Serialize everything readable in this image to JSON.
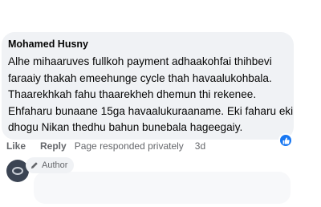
{
  "comment": {
    "author": "Mohamed Husny",
    "lines": [
      "Alhe mihaaruves fullkoh payment adhaakohfai thihbevi",
      "faraaiy thakah emeehunge cycle thah havaalukohbala.",
      "Thaarekhkah fahu thaarekheh dhemun thi rekenee.",
      "Ehfaharu bunaane 15ga havaalukuraaname. Eki faharu eki",
      "dhogu Nikan thedhu bahun bunebala hageegaiy."
    ],
    "reaction": "like-icon"
  },
  "actions": {
    "like": "Like",
    "reply": "Reply",
    "status": "Page responded privately",
    "time": "3d"
  },
  "reply": {
    "author_badge": "Author"
  },
  "colors": {
    "bubble": "#f0f2f5",
    "secondary_text": "#65676b",
    "accent": "#1877f2"
  }
}
